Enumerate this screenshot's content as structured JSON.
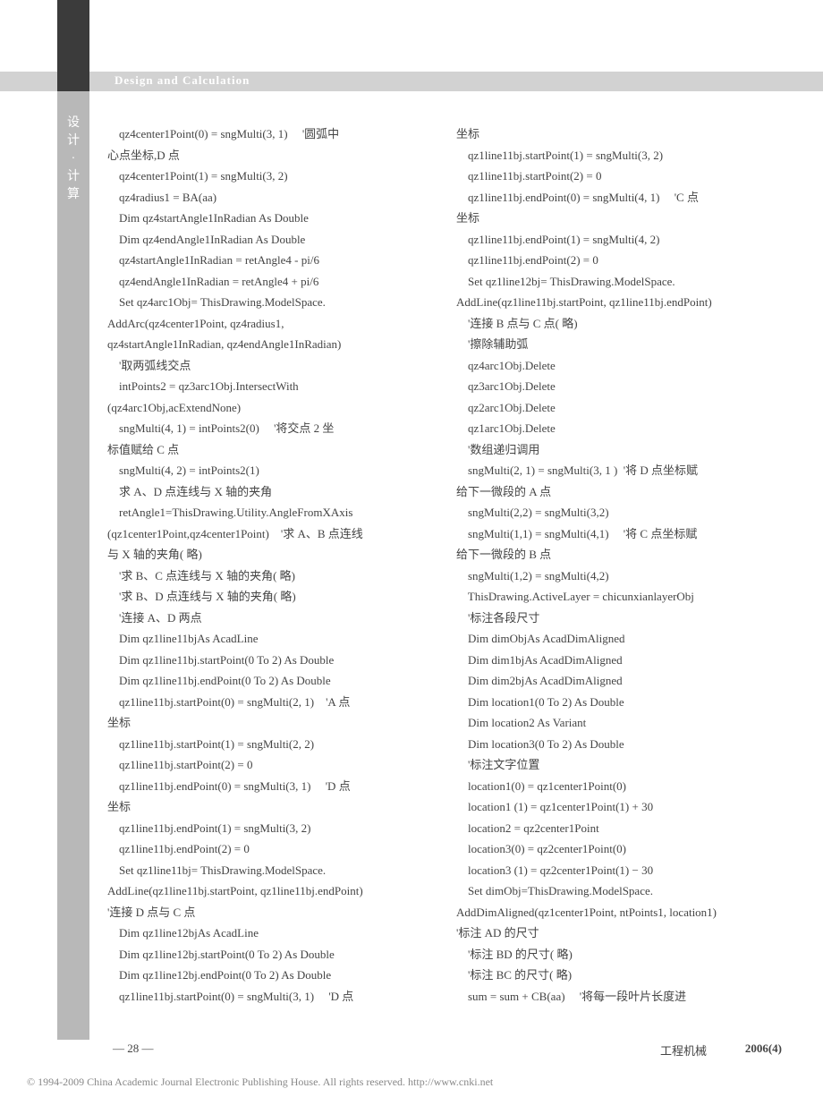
{
  "header": {
    "title": "Design and Calculation",
    "vertical": [
      "设",
      "计",
      "·",
      "计",
      "算"
    ]
  },
  "columns": {
    "left": "    qz4center1Point(0) = sngMulti(3, 1)     '圆弧中\n心点坐标,D 点\n    qz4center1Point(1) = sngMulti(3, 2)\n    qz4radius1 = BA(aa)\n    Dim qz4startAngle1InRadian As Double\n    Dim qz4endAngle1InRadian As Double\n    qz4startAngle1InRadian = retAngle4 - pi/6\n    qz4endAngle1InRadian = retAngle4 + pi/6\n    Set qz4arc1Obj= ThisDrawing.ModelSpace.\nAddArc(qz4center1Point, qz4radius1,\nqz4startAngle1InRadian, qz4endAngle1InRadian)\n    '取两弧线交点\n    intPoints2 = qz3arc1Obj.IntersectWith\n(qz4arc1Obj,acExtendNone)\n    sngMulti(4, 1) = intPoints2(0)     '将交点 2 坐\n标值赋给 C 点\n    sngMulti(4, 2) = intPoints2(1)\n    求 A、D 点连线与 X 轴的夹角\n    retAngle1=ThisDrawing.Utility.AngleFromXAxis\n(qz1center1Point,qz4center1Point)    '求 A、B 点连线\n与 X 轴的夹角( 略)\n    '求 B、C 点连线与 X 轴的夹角( 略)\n    '求 B、D 点连线与 X 轴的夹角( 略)\n    '连接 A、D 两点\n    Dim qz1line11bjAs AcadLine\n    Dim qz1line11bj.startPoint(0 To 2) As Double\n    Dim qz1line11bj.endPoint(0 To 2) As Double\n    qz1line11bj.startPoint(0) = sngMulti(2, 1)    'A 点\n坐标\n    qz1line11bj.startPoint(1) = sngMulti(2, 2)\n    qz1line11bj.startPoint(2) = 0\n    qz1line11bj.endPoint(0) = sngMulti(3, 1)     'D 点\n坐标\n    qz1line11bj.endPoint(1) = sngMulti(3, 2)\n    qz1line11bj.endPoint(2) = 0\n    Set qz1line11bj= ThisDrawing.ModelSpace.\nAddLine(qz1line11bj.startPoint, qz1line11bj.endPoint)\n'连接 D 点与 C 点\n    Dim qz1line12bjAs AcadLine\n    Dim qz1line12bj.startPoint(0 To 2) As Double\n    Dim qz1line12bj.endPoint(0 To 2) As Double\n    qz1line11bj.startPoint(0) = sngMulti(3, 1)     'D 点",
    "right": "坐标\n    qz1line11bj.startPoint(1) = sngMulti(3, 2)\n    qz1line11bj.startPoint(2) = 0\n    qz1line11bj.endPoint(0) = sngMulti(4, 1)     'C 点\n坐标\n    qz1line11bj.endPoint(1) = sngMulti(4, 2)\n    qz1line11bj.endPoint(2) = 0\n    Set qz1line12bj= ThisDrawing.ModelSpace.\nAddLine(qz1line11bj.startPoint, qz1line11bj.endPoint)\n    '连接 B 点与 C 点( 略)\n    '擦除辅助弧\n    qz4arc1Obj.Delete\n    qz3arc1Obj.Delete\n    qz2arc1Obj.Delete\n    qz1arc1Obj.Delete\n    '数组递归调用\n    sngMulti(2, 1) = sngMulti(3, 1 )  '将 D 点坐标赋\n给下一微段的 A 点\n    sngMulti(2,2) = sngMulti(3,2)\n    sngMulti(1,1) = sngMulti(4,1)     '将 C 点坐标赋\n给下一微段的 B 点\n    sngMulti(1,2) = sngMulti(4,2)\n    ThisDrawing.ActiveLayer = chicunxianlayerObj\n    '标注各段尺寸\n    Dim dimObjAs AcadDimAligned\n    Dim dim1bjAs AcadDimAligned\n    Dim dim2bjAs AcadDimAligned\n    Dim location1(0 To 2) As Double\n    Dim location2 As Variant\n    Dim location3(0 To 2) As Double\n    '标注文字位置\n    location1(0) = qz1center1Point(0)\n    location1 (1) = qz1center1Point(1) + 30\n    location2 = qz2center1Point\n    location3(0) = qz2center1Point(0)\n    location3 (1) = qz2center1Point(1) − 30\n    Set dimObj=ThisDrawing.ModelSpace.\nAddDimAligned(qz1center1Point, ntPoints1, location1)\n'标注 AD 的尺寸\n    '标注 BD 的尺寸( 略)\n    '标注 BC 的尺寸( 略)\n    sum = sum + CB(aa)     '将每一段叶片长度进"
  },
  "footer": {
    "page": "— 28 —",
    "journal": "工程机械",
    "issue": "2006(4)",
    "copyright": "© 1994-2009 China Academic Journal Electronic Publishing House. All rights reserved.    http://www.cnki.net"
  }
}
